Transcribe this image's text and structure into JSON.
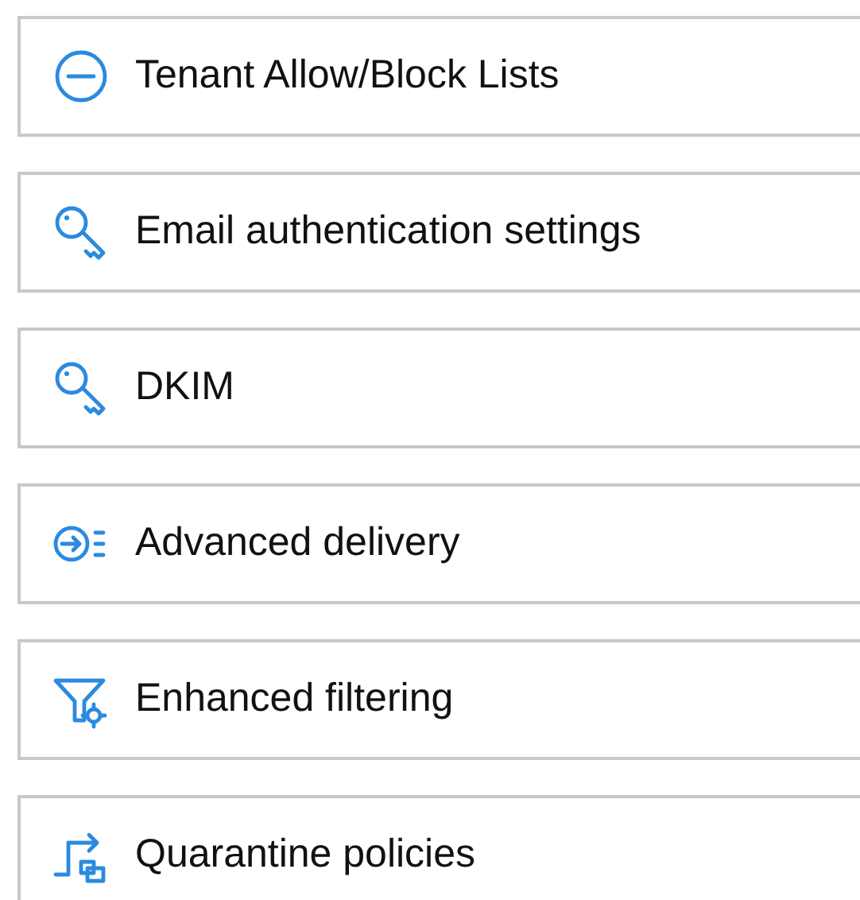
{
  "items": [
    {
      "kind": "block",
      "label": "Tenant Allow/Block Lists"
    },
    {
      "kind": "key",
      "label": "Email authentication settings"
    },
    {
      "kind": "key",
      "label": "DKIM"
    },
    {
      "kind": "delivery",
      "label": "Advanced delivery"
    },
    {
      "kind": "filter",
      "label": "Enhanced filtering"
    },
    {
      "kind": "quarantine",
      "label": "Quarantine policies"
    }
  ]
}
